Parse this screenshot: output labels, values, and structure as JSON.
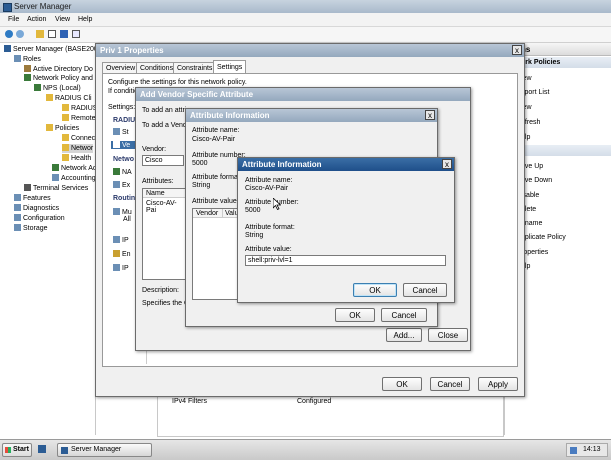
{
  "window": {
    "title": "Server Manager"
  },
  "menu": [
    "File",
    "Action",
    "View",
    "Help"
  ],
  "tree": {
    "root": "Server Manager (BASE200",
    "roles": "Roles",
    "ad": "Active Directory Do",
    "npas": "Network Policy and",
    "nps": "NPS (Local)",
    "radius_clients": "RADIUS Cli",
    "radius": "RADIUS",
    "remote": "Remote",
    "policies": "Policies",
    "connect": "Connec",
    "network": "Networ",
    "health": "Health",
    "network_access": "Network Ac",
    "accounting": "Accounting",
    "terminal": "Terminal Services",
    "features": "Features",
    "diagnostics": "Diagnostics",
    "configuration": "Configuration",
    "storage": "Storage"
  },
  "actions": {
    "header": "ns",
    "section": "ork Policies",
    "items": [
      "iew",
      "xport List",
      "iew",
      "efresh",
      "elp",
      "ove Up",
      "ove Down",
      "isable",
      "elete",
      "ename",
      "uplicate Policy",
      "roperties",
      "elp"
    ]
  },
  "background_row": {
    "name": "IPv4 Filters",
    "value": "Configured"
  },
  "props_dialog": {
    "title": "Priv 1 Properties",
    "tabs": [
      "Overview",
      "Conditions",
      "Constraints",
      "Settings"
    ],
    "description": "Configure the settings for this network policy.",
    "condition_note": "If conditio",
    "settings_label": "Settings:",
    "nav_radius": "RADIUS",
    "nav_st": "St",
    "nav_ve": "Ve",
    "nav_network": "Netwo",
    "nav_na": "NA",
    "nav_ex": "Ex",
    "nav_routing": "Routin",
    "nav_mu": "Mu",
    "nav_all": "All",
    "nav_ip": "IP",
    "nav_en": "En",
    "nav_ip2": "IP",
    "ok": "OK",
    "cancel": "Cancel",
    "apply": "Apply"
  },
  "vsa_dialog": {
    "title": "Add Vendor Specific Attribute",
    "add_text_1": "To add an attri",
    "add_text_2": "To add a Vend",
    "vendor_label": "Vendor:",
    "vendor_value": "Cisco",
    "attributes_label": "Attributes:",
    "col_name": "Name",
    "row_name": "Cisco-AV-Pai",
    "description_label": "Description:",
    "description_text": "Specifies the C",
    "add": "Add...",
    "close": "Close"
  },
  "attr_dialog_1": {
    "title": "Attribute Information",
    "name_label": "Attribute name:",
    "name_value": "Cisco-AV-Pair",
    "number_label": "Attribute number:",
    "number_value": "5000",
    "format_label": "Attribute format:",
    "format_value": "String",
    "values_label": "Attribute values:",
    "col_vendor": "Vendor",
    "col_value": "Valu",
    "ok": "OK",
    "cancel": "Cancel"
  },
  "attr_dialog_2": {
    "title": "Attribute Information",
    "name_label": "Attribute name:",
    "name_value": "Cisco-AV-Pair",
    "number_label": "Attribute number:",
    "number_value": "5000",
    "format_label": "Attribute format:",
    "format_value": "String",
    "value_label": "Attribute value:",
    "value_input": "shell:priv-lvl=1",
    "ok": "OK",
    "cancel": "Cancel"
  },
  "taskbar": {
    "start": "Start",
    "task": "Server Manager",
    "clock": "14:13"
  },
  "colors": {
    "titlebar": "#2b5c94",
    "desktop": "#ffffff",
    "accent": "#3c7fb1"
  }
}
